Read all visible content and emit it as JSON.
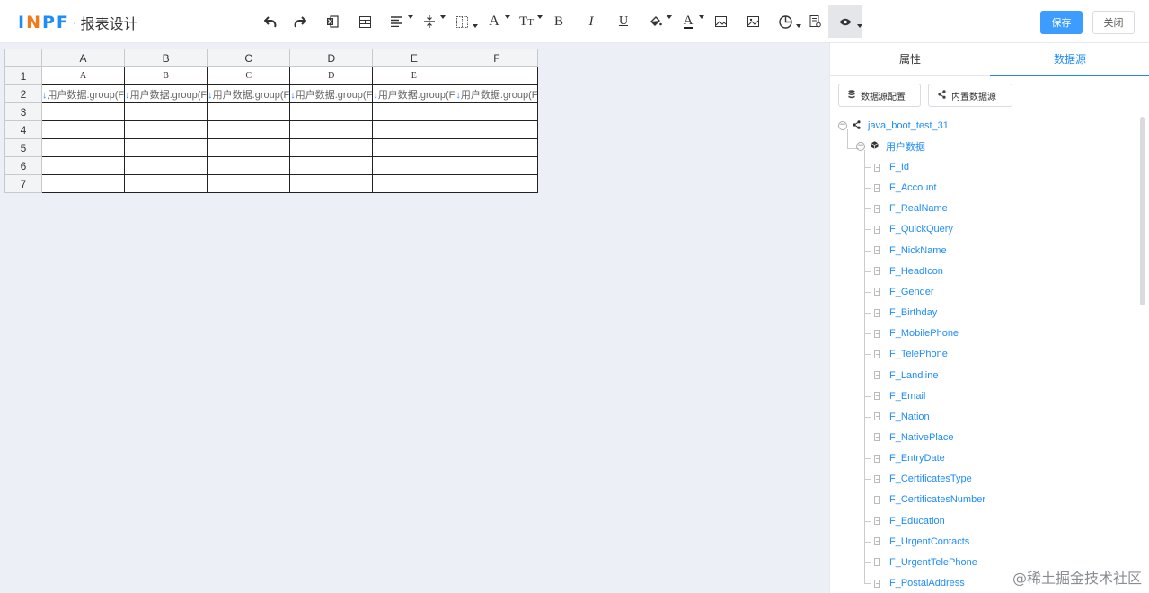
{
  "app": {
    "logo": "INPF",
    "title": "报表设计"
  },
  "header": {
    "save_label": "保存",
    "close_label": "关闭"
  },
  "toolbar": [
    {
      "name": "undo-icon",
      "glyph": "↶"
    },
    {
      "name": "redo-icon",
      "glyph": "↷"
    },
    {
      "name": "excel-icon",
      "glyph": "▣"
    },
    {
      "name": "merge-cells-icon",
      "glyph": "▤"
    },
    {
      "name": "align-left-icon",
      "glyph": "≡"
    },
    {
      "name": "vertical-align-icon",
      "glyph": "÷"
    },
    {
      "name": "border-icon",
      "glyph": "⊞"
    },
    {
      "name": "font-family-icon",
      "glyph": "A"
    },
    {
      "name": "font-size-icon",
      "glyph": "Tт"
    },
    {
      "name": "bold-icon",
      "glyph": "B"
    },
    {
      "name": "italic-icon",
      "glyph": "I"
    },
    {
      "name": "underline-icon",
      "glyph": "U"
    },
    {
      "name": "fill-color-icon",
      "glyph": "◈"
    },
    {
      "name": "font-color-icon",
      "glyph": "A"
    },
    {
      "name": "image-icon",
      "glyph": "▨"
    },
    {
      "name": "picture-icon",
      "glyph": "▩"
    },
    {
      "name": "chart-icon",
      "glyph": "◔"
    },
    {
      "name": "print-icon",
      "glyph": "▦"
    },
    {
      "name": "preview-icon",
      "glyph": "◉"
    }
  ],
  "sheet": {
    "columns": [
      "A",
      "B",
      "C",
      "D",
      "E",
      "F"
    ],
    "rows": [
      "1",
      "2",
      "3",
      "4",
      "5",
      "6",
      "7"
    ],
    "row1": [
      "A",
      "B",
      "C",
      "D",
      "E",
      ""
    ],
    "row2": [
      "用户数据.group(F",
      "用户数据.group(F",
      "用户数据.group(F",
      "用户数据.group(F",
      "用户数据.group(F",
      "用户数据.group(F"
    ]
  },
  "panel": {
    "tabs": [
      "属性",
      "数据源"
    ],
    "active_tab": "数据源",
    "buttons": [
      "数据源配置",
      "内置数据源"
    ],
    "tree": {
      "root": "java_boot_test_31",
      "dataset": "用户数据",
      "fields": [
        "F_Id",
        "F_Account",
        "F_RealName",
        "F_QuickQuery",
        "F_NickName",
        "F_HeadIcon",
        "F_Gender",
        "F_Birthday",
        "F_MobilePhone",
        "F_TelePhone",
        "F_Landline",
        "F_Email",
        "F_Nation",
        "F_NativePlace",
        "F_EntryDate",
        "F_CertificatesType",
        "F_CertificatesNumber",
        "F_Education",
        "F_UrgentContacts",
        "F_UrgentTelePhone",
        "F_PostalAddress"
      ]
    }
  },
  "watermark": "@稀土掘金技术社区",
  "colors": {
    "accent": "#1e8cfa",
    "logo_orange": "#f27a1a",
    "save_button": "#3c9cff",
    "canvas_bg": "#eceff6"
  }
}
